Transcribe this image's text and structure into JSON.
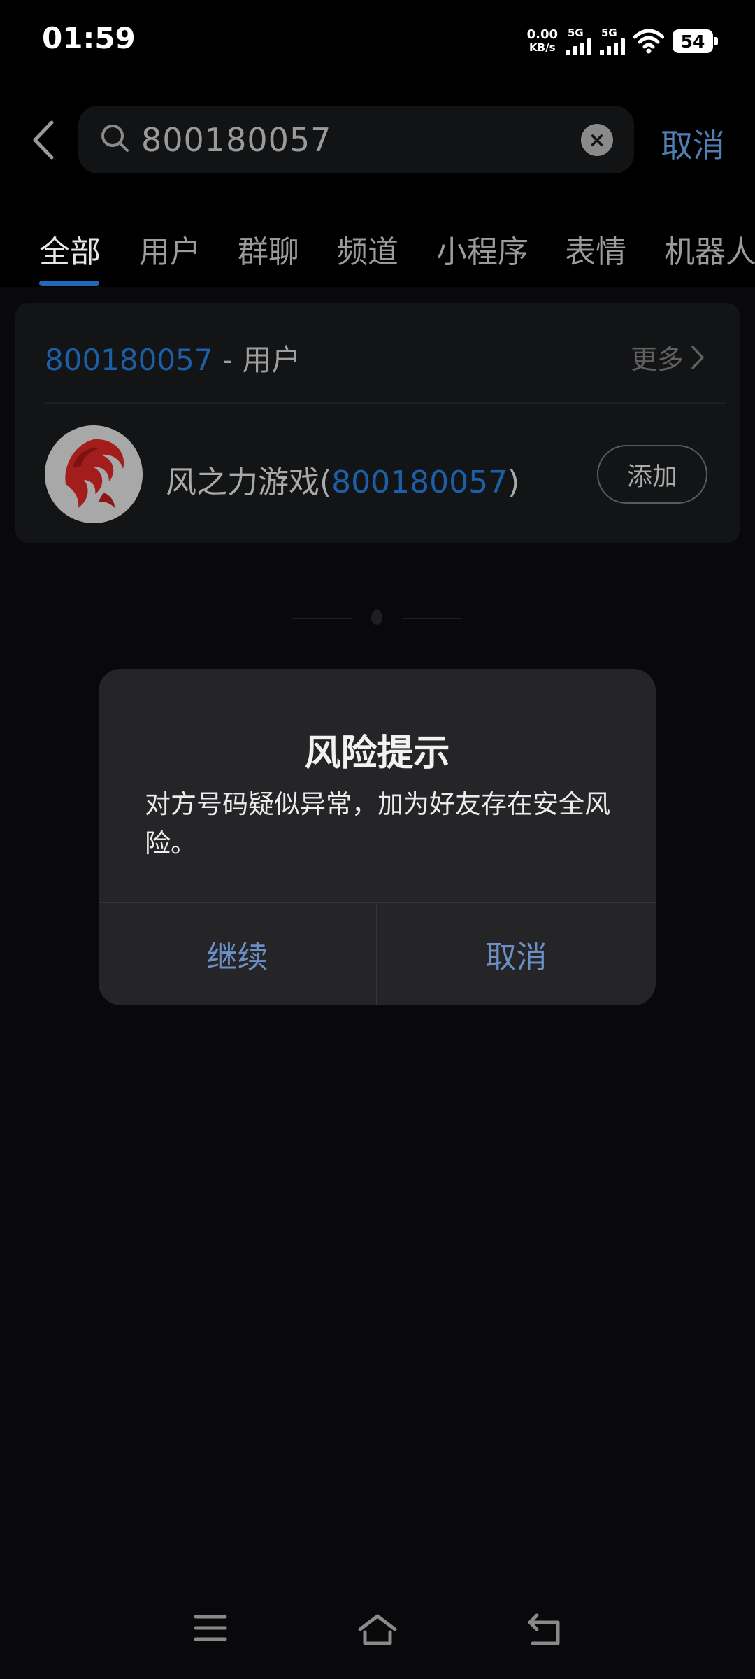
{
  "status_bar": {
    "time": "01:59",
    "net_speed_value": "0.00",
    "net_speed_unit": "KB/s",
    "sim1_label": "5G",
    "sim2_label": "5G",
    "battery": "54"
  },
  "search": {
    "query": "800180057",
    "cancel_label": "取消"
  },
  "tabs": [
    {
      "label": "全部",
      "active": true
    },
    {
      "label": "用户"
    },
    {
      "label": "群聊"
    },
    {
      "label": "频道"
    },
    {
      "label": "小程序"
    },
    {
      "label": "表情"
    },
    {
      "label": "机器人"
    }
  ],
  "result": {
    "query_highlight": "800180057",
    "category": " - 用户",
    "more_label": "更多",
    "name_prefix": "风之力游戏(",
    "name_id": "800180057",
    "name_suffix": ")",
    "add_label": "添加"
  },
  "dialog": {
    "title": "风险提示",
    "message": "对方号码疑似异常，加为好友存在安全风险。",
    "continue_label": "继续",
    "cancel_label": "取消",
    "button_color": "#6b90c7"
  },
  "colors": {
    "accent": "#1c5fa6",
    "background": "#000000"
  }
}
